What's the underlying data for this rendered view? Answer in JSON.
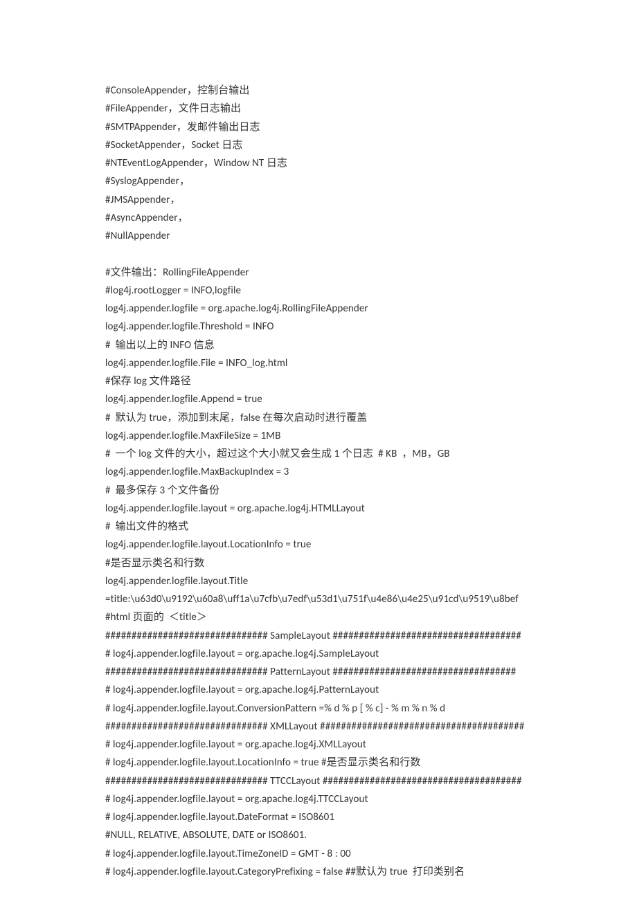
{
  "lines": [
    "#ConsoleAppender，控制台输出",
    "#FileAppender，文件日志输出",
    "#SMTPAppender，发邮件输出日志",
    "#SocketAppender，Socket 日志",
    "#NTEventLogAppender，Window NT 日志",
    "#SyslogAppender，",
    "#JMSAppender，",
    "#AsyncAppender，",
    "#NullAppender",
    "",
    "#文件输出：RollingFileAppender",
    "#log4j.rootLogger = INFO,logfile",
    "log4j.appender.logfile = org.apache.log4j.RollingFileAppender",
    "log4j.appender.logfile.Threshold = INFO",
    "#  输出以上的 INFO 信息",
    "log4j.appender.logfile.File = INFO_log.html",
    "#保存 log 文件路径",
    "log4j.appender.logfile.Append = true",
    "#  默认为 true，添加到末尾，false 在每次启动时进行覆盖",
    "log4j.appender.logfile.MaxFileSize = 1MB",
    "#  一个 log 文件的大小，超过这个大小就又会生成 1 个日志  # KB  ，MB，GB",
    "log4j.appender.logfile.MaxBackupIndex = 3",
    "#  最多保存 3 个文件备份",
    "log4j.appender.logfile.layout = org.apache.log4j.HTMLLayout",
    "#  输出文件的格式",
    "log4j.appender.logfile.layout.LocationInfo = true",
    "#是否显示类名和行数",
    "log4j.appender.logfile.layout.Title",
    "=title:\\u63d0\\u9192\\u60a8\\uff1a\\u7cfb\\u7edf\\u53d1\\u751f\\u4e86\\u4e25\\u91cd\\u9519\\u8bef",
    "#html 页面的  ＜title＞",
    "############################### SampleLayout ####################################",
    "# log4j.appender.logfile.layout = org.apache.log4j.SampleLayout",
    "############################### PatternLayout ###################################",
    "# log4j.appender.logfile.layout = org.apache.log4j.PatternLayout",
    "# log4j.appender.logfile.layout.ConversionPattern =% d % p [ % c] - % m % n % d",
    "############################### XMLLayout #######################################",
    "# log4j.appender.logfile.layout = org.apache.log4j.XMLLayout",
    "# log4j.appender.logfile.layout.LocationInfo = true #是否显示类名和行数",
    "############################### TTCCLayout ######################################",
    "# log4j.appender.logfile.layout = org.apache.log4j.TTCCLayout",
    "# log4j.appender.logfile.layout.DateFormat = ISO8601",
    "#NULL, RELATIVE, ABSOLUTE, DATE or ISO8601.",
    "# log4j.appender.logfile.layout.TimeZoneID = GMT - 8 : 00",
    "# log4j.appender.logfile.layout.CategoryPrefixing = false ##默认为 true  打印类别名"
  ]
}
